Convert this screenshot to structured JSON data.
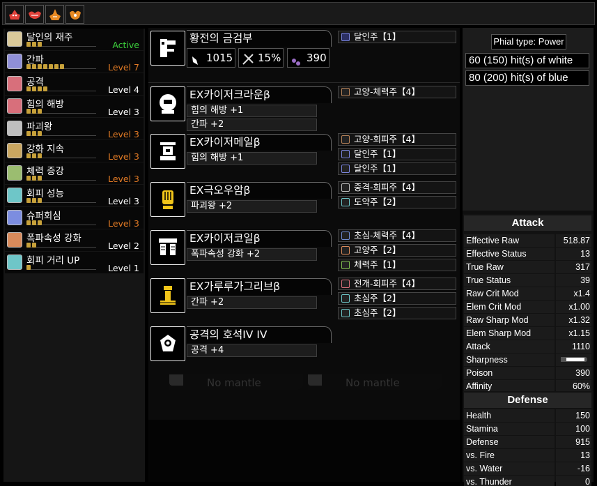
{
  "monster_icons": [
    {
      "icon": "monster-crab-icon",
      "color": "#e0413a"
    },
    {
      "icon": "monster-wing-icon",
      "color": "#e0413a"
    },
    {
      "icon": "monster-horn-icon",
      "color": "#e88a24"
    },
    {
      "icon": "monster-claw-icon",
      "color": "#e88a24"
    }
  ],
  "skills": [
    {
      "name": "달인의 재주",
      "pips": 3,
      "level": "Active",
      "level_color": "green",
      "icon_color": "#d9c99a"
    },
    {
      "name": "간파",
      "pips": 7,
      "level": "Level 7",
      "level_color": "orange",
      "icon_color": "#8f8fd8"
    },
    {
      "name": "공격",
      "pips": 4,
      "level": "Level 4",
      "level_color": "white",
      "icon_color": "#d86f7b"
    },
    {
      "name": "힘의 해방",
      "pips": 3,
      "level": "Level 3",
      "level_color": "white",
      "icon_color": "#d86f7b"
    },
    {
      "name": "파괴왕",
      "pips": 3,
      "level": "Level 3",
      "level_color": "orange",
      "icon_color": "#bfbfbf"
    },
    {
      "name": "강화 지속",
      "pips": 3,
      "level": "Level 3",
      "level_color": "orange",
      "icon_color": "#c9a660"
    },
    {
      "name": "체력 증강",
      "pips": 3,
      "level": "Level 3",
      "level_color": "orange",
      "icon_color": "#9bbd70"
    },
    {
      "name": "회피 성능",
      "pips": 3,
      "level": "Level 3",
      "level_color": "white",
      "icon_color": "#6ec6c8"
    },
    {
      "name": "슈퍼회심",
      "pips": 3,
      "level": "Level 3",
      "level_color": "orange",
      "icon_color": "#7c8de0"
    },
    {
      "name": "폭파속성 강화",
      "pips": 2,
      "level": "Level 2",
      "level_color": "white",
      "icon_color": "#d88a5b"
    },
    {
      "name": "회피 거리 UP",
      "pips": 1,
      "level": "Level 1",
      "level_color": "white",
      "icon_color": "#6ec6c8"
    }
  ],
  "weapon": {
    "name": "황전의 금검부",
    "attack": "1015",
    "affinity": "15%",
    "element": "390",
    "decoration": "달인주【1】"
  },
  "armor": [
    {
      "name": "EX카이저크라운β",
      "skills": [
        "힘의 해방 +1",
        "간파 +2"
      ],
      "decorations": [
        "고양-체력주【4】"
      ]
    },
    {
      "name": "EX카이저메일β",
      "skills": [
        "힘의 해방 +1"
      ],
      "decorations": [
        "고양-회피주【4】",
        "달인주【1】",
        "달인주【1】"
      ]
    },
    {
      "name": "EX극오우암β",
      "skills": [
        "파괴왕 +2"
      ],
      "decorations": [
        "중격-회피주【4】",
        "도약주【2】"
      ]
    },
    {
      "name": "EX카이저코일β",
      "skills": [
        "폭파속성 강화 +2"
      ],
      "decorations": [
        "초심-체력주【4】",
        "고양주【2】",
        "체력주【1】"
      ]
    },
    {
      "name": "EX가루루가그리브β",
      "skills": [
        "간파 +2"
      ],
      "decorations": [
        "전개-회피주【4】",
        "초심주【2】",
        "초심주【2】"
      ]
    },
    {
      "name": "공격의 호석IV IV",
      "skills": [
        "공격 +4"
      ],
      "decorations": []
    }
  ],
  "mantles": [
    "No mantle",
    "No mantle"
  ],
  "phial": {
    "type_label": "Phial type: Power",
    "white_hits": "60 (150) hit(s) of white",
    "blue_hits": "80 (200) hit(s) of blue"
  },
  "attack": {
    "title": "Attack",
    "rows": [
      {
        "label": "Effective Raw",
        "value": "518.87"
      },
      {
        "label": "Effective Status",
        "value": "13"
      },
      {
        "label": "True Raw",
        "value": "317"
      },
      {
        "label": "True Status",
        "value": "39"
      },
      {
        "label": "Raw Crit Mod",
        "value": "x1.4"
      },
      {
        "label": "Elem Crit Mod",
        "value": "x1.00"
      },
      {
        "label": "Raw Sharp Mod",
        "value": "x1.32"
      },
      {
        "label": "Elem Sharp Mod",
        "value": "x1.15"
      },
      {
        "label": "Attack",
        "value": "1110"
      },
      {
        "label": "Sharpness",
        "value": ""
      },
      {
        "label": "Poison",
        "value": "390"
      },
      {
        "label": "Affinity",
        "value": "60%"
      }
    ]
  },
  "defense": {
    "title": "Defense",
    "rows": [
      {
        "label": "Health",
        "value": "150"
      },
      {
        "label": "Stamina",
        "value": "100"
      },
      {
        "label": "Defense",
        "value": "915"
      },
      {
        "label": "vs. Fire",
        "value": "13"
      },
      {
        "label": "vs. Water",
        "value": "-16"
      },
      {
        "label": "vs. Thunder",
        "value": "0"
      }
    ]
  }
}
